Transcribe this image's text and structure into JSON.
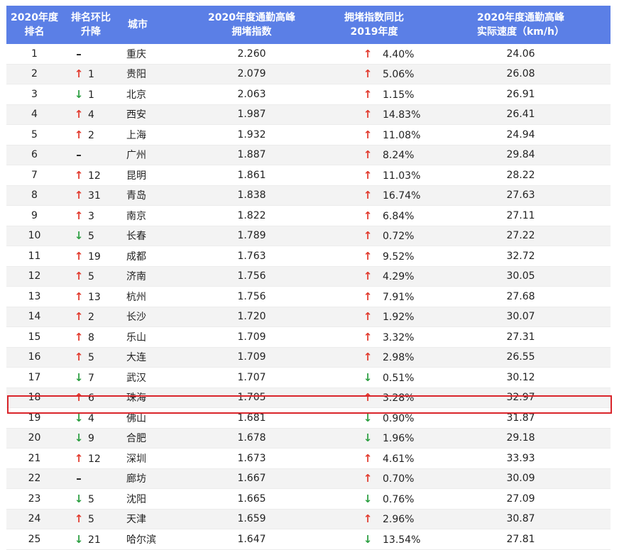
{
  "header": {
    "rank": [
      "2020年度",
      "排名"
    ],
    "change": [
      "排名环比",
      "升降"
    ],
    "city": "城市",
    "index": [
      "2020年度通勤高峰",
      "拥堵指数"
    ],
    "yoy": [
      "拥堵指数同比",
      "2019年度"
    ],
    "speed": [
      "2020年度通勤高峰",
      "实际速度（km/h）"
    ]
  },
  "colors": {
    "header_bg": "#5b7fe6",
    "up": "#e23b2e",
    "down": "#2ea043",
    "highlight": "#d9252b"
  },
  "highlighted_row": "19",
  "rows": [
    {
      "rank": "1",
      "dir": "flat",
      "delta": "",
      "city": "重庆",
      "index": "2.260",
      "yoy_dir": "up",
      "yoy": "4.40%",
      "speed": "24.06"
    },
    {
      "rank": "2",
      "dir": "up",
      "delta": "1",
      "city": "贵阳",
      "index": "2.079",
      "yoy_dir": "up",
      "yoy": "5.06%",
      "speed": "26.08"
    },
    {
      "rank": "3",
      "dir": "down",
      "delta": "1",
      "city": "北京",
      "index": "2.063",
      "yoy_dir": "up",
      "yoy": "1.15%",
      "speed": "26.91"
    },
    {
      "rank": "4",
      "dir": "up",
      "delta": "4",
      "city": "西安",
      "index": "1.987",
      "yoy_dir": "up",
      "yoy": "14.83%",
      "speed": "26.41"
    },
    {
      "rank": "5",
      "dir": "up",
      "delta": "2",
      "city": "上海",
      "index": "1.932",
      "yoy_dir": "up",
      "yoy": "11.08%",
      "speed": "24.94"
    },
    {
      "rank": "6",
      "dir": "flat",
      "delta": "",
      "city": "广州",
      "index": "1.887",
      "yoy_dir": "up",
      "yoy": "8.24%",
      "speed": "29.84"
    },
    {
      "rank": "7",
      "dir": "up",
      "delta": "12",
      "city": "昆明",
      "index": "1.861",
      "yoy_dir": "up",
      "yoy": "11.03%",
      "speed": "28.22"
    },
    {
      "rank": "8",
      "dir": "up",
      "delta": "31",
      "city": "青岛",
      "index": "1.838",
      "yoy_dir": "up",
      "yoy": "16.74%",
      "speed": "27.63"
    },
    {
      "rank": "9",
      "dir": "up",
      "delta": "3",
      "city": "南京",
      "index": "1.822",
      "yoy_dir": "up",
      "yoy": "6.84%",
      "speed": "27.11"
    },
    {
      "rank": "10",
      "dir": "down",
      "delta": "5",
      "city": "长春",
      "index": "1.789",
      "yoy_dir": "up",
      "yoy": "0.72%",
      "speed": "27.22"
    },
    {
      "rank": "11",
      "dir": "up",
      "delta": "19",
      "city": "成都",
      "index": "1.763",
      "yoy_dir": "up",
      "yoy": "9.52%",
      "speed": "32.72"
    },
    {
      "rank": "12",
      "dir": "up",
      "delta": "5",
      "city": "济南",
      "index": "1.756",
      "yoy_dir": "up",
      "yoy": "4.29%",
      "speed": "30.05"
    },
    {
      "rank": "13",
      "dir": "up",
      "delta": "13",
      "city": "杭州",
      "index": "1.756",
      "yoy_dir": "up",
      "yoy": "7.91%",
      "speed": "27.68"
    },
    {
      "rank": "14",
      "dir": "up",
      "delta": "2",
      "city": "长沙",
      "index": "1.720",
      "yoy_dir": "up",
      "yoy": "1.92%",
      "speed": "30.07"
    },
    {
      "rank": "15",
      "dir": "up",
      "delta": "8",
      "city": "乐山",
      "index": "1.709",
      "yoy_dir": "up",
      "yoy": "3.32%",
      "speed": "27.31"
    },
    {
      "rank": "16",
      "dir": "up",
      "delta": "5",
      "city": "大连",
      "index": "1.709",
      "yoy_dir": "up",
      "yoy": "2.98%",
      "speed": "26.55"
    },
    {
      "rank": "17",
      "dir": "down",
      "delta": "7",
      "city": "武汉",
      "index": "1.707",
      "yoy_dir": "down",
      "yoy": "0.51%",
      "speed": "30.12"
    },
    {
      "rank": "18",
      "dir": "up",
      "delta": "6",
      "city": "珠海",
      "index": "1.705",
      "yoy_dir": "up",
      "yoy": "3.28%",
      "speed": "32.97"
    },
    {
      "rank": "19",
      "dir": "down",
      "delta": "4",
      "city": "佛山",
      "index": "1.681",
      "yoy_dir": "down",
      "yoy": "0.90%",
      "speed": "31.87"
    },
    {
      "rank": "20",
      "dir": "down",
      "delta": "9",
      "city": "合肥",
      "index": "1.678",
      "yoy_dir": "down",
      "yoy": "1.96%",
      "speed": "29.18"
    },
    {
      "rank": "21",
      "dir": "up",
      "delta": "12",
      "city": "深圳",
      "index": "1.673",
      "yoy_dir": "up",
      "yoy": "4.61%",
      "speed": "33.93"
    },
    {
      "rank": "22",
      "dir": "flat",
      "delta": "",
      "city": "廊坊",
      "index": "1.667",
      "yoy_dir": "up",
      "yoy": "0.70%",
      "speed": "30.09"
    },
    {
      "rank": "23",
      "dir": "down",
      "delta": "5",
      "city": "沈阳",
      "index": "1.665",
      "yoy_dir": "down",
      "yoy": "0.76%",
      "speed": "27.09"
    },
    {
      "rank": "24",
      "dir": "up",
      "delta": "5",
      "city": "天津",
      "index": "1.659",
      "yoy_dir": "up",
      "yoy": "2.96%",
      "speed": "30.87"
    },
    {
      "rank": "25",
      "dir": "down",
      "delta": "21",
      "city": "哈尔滨",
      "index": "1.647",
      "yoy_dir": "down",
      "yoy": "13.54%",
      "speed": "27.81"
    }
  ]
}
